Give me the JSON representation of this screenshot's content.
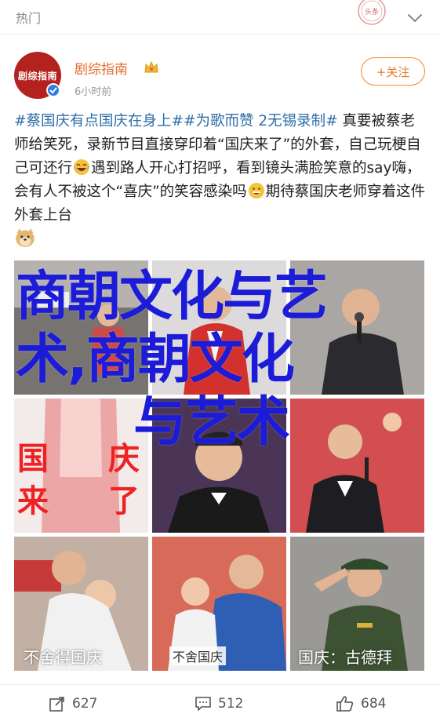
{
  "topbar": {
    "title": "热门",
    "stamp_text": "头条"
  },
  "post": {
    "author": "剧综指南",
    "avatar_text": "剧综指南",
    "time": "6小时前",
    "follow_label": "+关注",
    "text": {
      "tag1": "#蔡国庆有点国庆在身上#",
      "tag2": "#为歌而赞 2无锡录制#",
      "seg1": " 真要被蔡老师给笑死，录新节目直接穿印着“国庆来了”的外套，自己玩梗自己可还行",
      "seg2": "遇到路人开心打招呼，看到镜头满脸笑意的say嗨，会有人不被这个“喜庆”的笑容感染吗",
      "seg3": "期待蔡国庆老师穿着这件外套上台"
    }
  },
  "overlay": {
    "line1": "商朝文化与艺",
    "line2": "术,商朝文化",
    "line3": "与艺术"
  },
  "images": [
    {
      "caption": ""
    },
    {
      "caption": ""
    },
    {
      "caption": ""
    },
    {
      "caption_a": "国",
      "caption_b": "来",
      "caption_c": "庆",
      "caption_d": "了"
    },
    {
      "caption": ""
    },
    {
      "caption": ""
    },
    {
      "caption": "不舍得国庆"
    },
    {
      "caption": "不舍国庆"
    },
    {
      "caption": "国庆：古德拜"
    }
  ],
  "actions": {
    "share_count": "627",
    "comment_count": "512",
    "like_count": "684"
  },
  "colors": {
    "author": "#e16e2e",
    "tag": "#2f6ea8",
    "overlay": "#1c1cd8",
    "follow": "#ee8a2d"
  }
}
